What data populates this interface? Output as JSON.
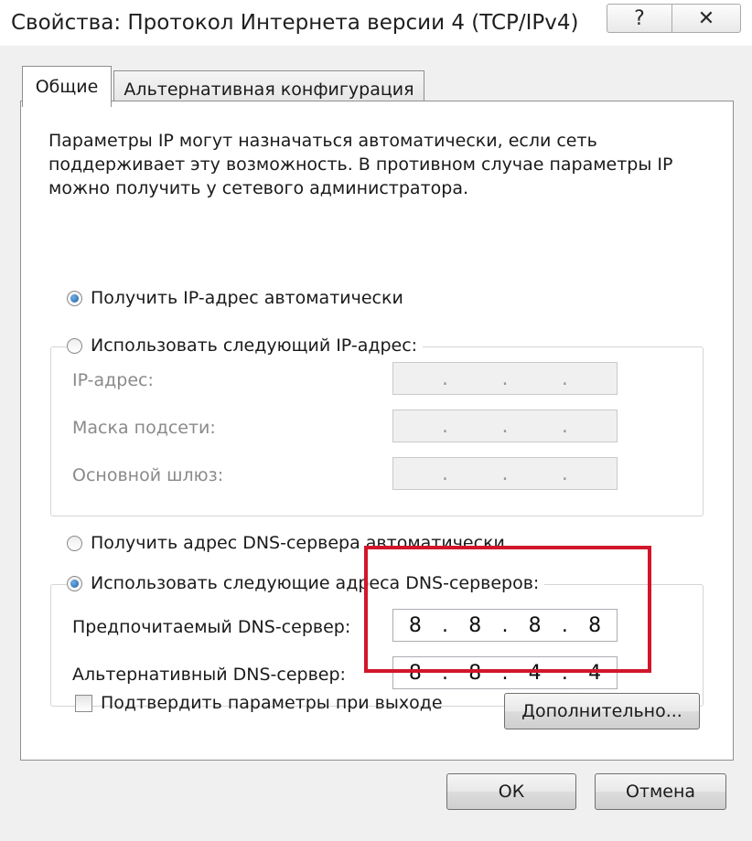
{
  "window": {
    "title": "Свойства: Протокол Интернета версии 4 (TCP/IPv4)",
    "help_glyph": "?",
    "close_glyph": "✕"
  },
  "tabs": [
    {
      "label": "Общие",
      "selected": true
    },
    {
      "label": "Альтернативная конфигурация",
      "selected": false
    }
  ],
  "description": "Параметры IP могут назначаться автоматически, если сеть поддерживает эту возможность. В противном случае параметры IP можно получить у сетевого администратора.",
  "ip_mode": {
    "auto_label": "Получить IP-адрес автоматически",
    "manual_label": "Использовать следующий IP-адрес:",
    "selected": "auto"
  },
  "ip_fields": [
    {
      "label": "IP-адрес:",
      "octets": [
        "",
        "",
        "",
        ""
      ]
    },
    {
      "label": "Маска подсети:",
      "octets": [
        "",
        "",
        "",
        ""
      ]
    },
    {
      "label": "Основной шлюз:",
      "octets": [
        "",
        "",
        "",
        ""
      ]
    }
  ],
  "dns_mode": {
    "auto_label": "Получить адрес DNS-сервера автоматически",
    "manual_label": "Использовать следующие адреса DNS-серверов:",
    "selected": "manual"
  },
  "dns_fields": [
    {
      "label": "Предпочитаемый DNS-сервер:",
      "octets": [
        "8",
        "8",
        "8",
        "8"
      ]
    },
    {
      "label": "Альтернативный DNS-сервер:",
      "octets": [
        "8",
        "8",
        "4",
        "4"
      ]
    }
  ],
  "validate": {
    "label": "Подтвердить параметры при выходе",
    "checked": false
  },
  "buttons": {
    "advanced": "Дополнительно...",
    "ok": "ОК",
    "cancel": "Отмена"
  },
  "colors": {
    "highlight": "#d1162a",
    "window_bg": "#f0f0f0"
  }
}
